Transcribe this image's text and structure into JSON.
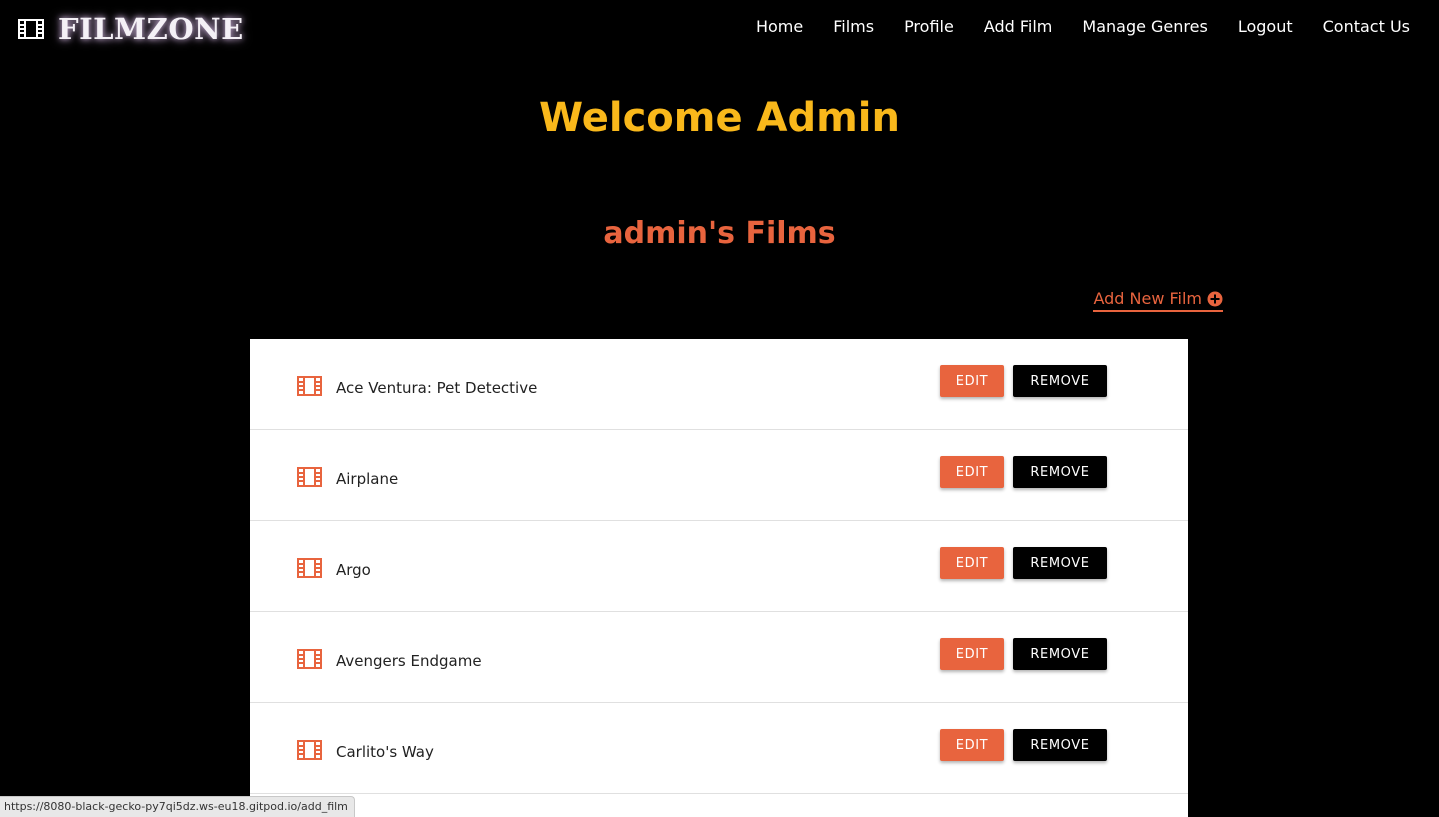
{
  "brand": {
    "name": "FILMZONE",
    "icon": "film-icon"
  },
  "nav": {
    "items": [
      {
        "label": "Home",
        "name": "nav-home"
      },
      {
        "label": "Films",
        "name": "nav-films"
      },
      {
        "label": "Profile",
        "name": "nav-profile"
      },
      {
        "label": "Add Film",
        "name": "nav-add-film"
      },
      {
        "label": "Manage Genres",
        "name": "nav-manage-genres"
      },
      {
        "label": "Logout",
        "name": "nav-logout"
      },
      {
        "label": "Contact Us",
        "name": "nav-contact-us"
      }
    ]
  },
  "welcome": "Welcome Admin",
  "films_heading": "admin's Films",
  "add_new_film": {
    "label": "Add New Film",
    "icon": "plus-circle-icon"
  },
  "films": [
    {
      "title": "Ace Ventura: Pet Detective",
      "edit_label": "EDIT",
      "remove_label": "REMOVE"
    },
    {
      "title": "Airplane",
      "edit_label": "EDIT",
      "remove_label": "REMOVE"
    },
    {
      "title": "Argo",
      "edit_label": "EDIT",
      "remove_label": "REMOVE"
    },
    {
      "title": "Avengers Endgame",
      "edit_label": "EDIT",
      "remove_label": "REMOVE"
    },
    {
      "title": "Carlito's Way",
      "edit_label": "EDIT",
      "remove_label": "REMOVE"
    }
  ],
  "status_url": "https://8080-black-gecko-py7qi5dz.ws-eu18.gitpod.io/add_film",
  "colors": {
    "accent": "#e8643e",
    "welcome": "#f9b81b",
    "background": "#000000"
  }
}
